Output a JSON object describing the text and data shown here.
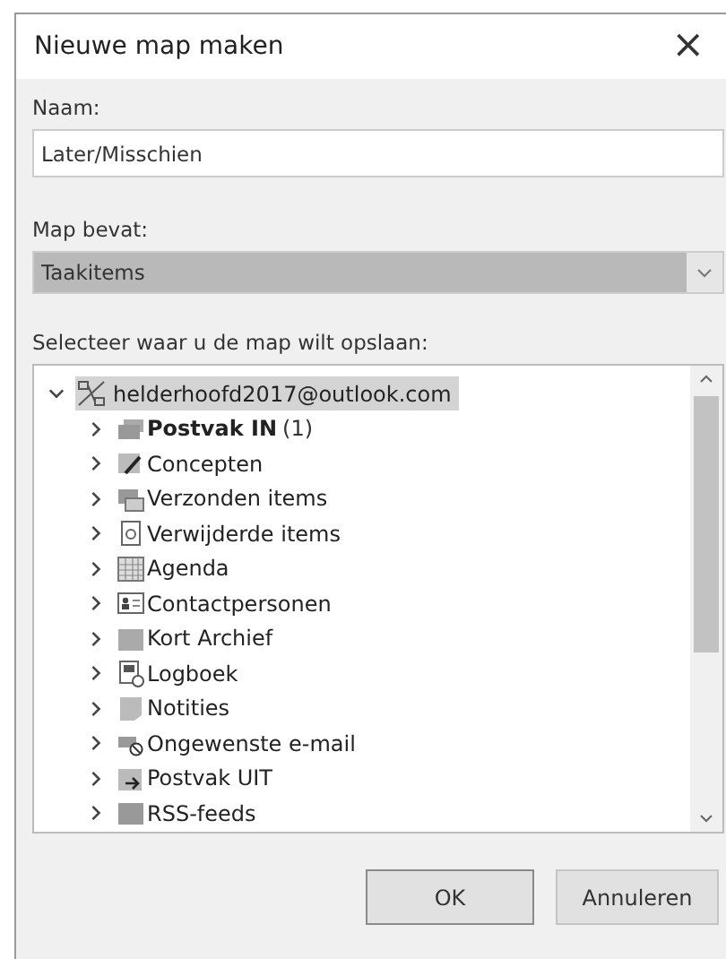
{
  "window": {
    "title": "Nieuwe map maken",
    "close": "×"
  },
  "name_field": {
    "label": "Naam:",
    "value": "Later/Misschien"
  },
  "contains": {
    "label": "Map bevat:",
    "value": "Taakitems",
    "selected": true
  },
  "location": {
    "label": "Selecteer waar u de map wilt opslaan:",
    "tree": [
      {
        "label": "helderhoofd2017@outlook.com",
        "expanded": true,
        "selected": true,
        "children": [
          {
            "label": "Postvak IN",
            "count": "(1)",
            "unread": true,
            "expanded": false,
            "selected": false
          },
          {
            "label": "Concepten",
            "unread": false,
            "expanded": false,
            "selected": false
          },
          {
            "label": "Verzonden items",
            "unread": false,
            "expanded": false,
            "selected": false
          },
          {
            "label": "Verwijderde items",
            "unread": false,
            "expanded": false,
            "selected": false
          },
          {
            "label": "Agenda",
            "unread": false,
            "expanded": false,
            "selected": false
          },
          {
            "label": "Contactpersonen",
            "unread": false,
            "expanded": false,
            "selected": false
          },
          {
            "label": "Kort Archief",
            "unread": false,
            "expanded": false,
            "selected": false
          },
          {
            "label": "Logboek",
            "unread": false,
            "expanded": false,
            "selected": false
          },
          {
            "label": "Notities",
            "unread": false,
            "expanded": false,
            "selected": false
          },
          {
            "label": "Ongewenste e-mail",
            "unread": false,
            "expanded": false,
            "selected": false
          },
          {
            "label": "Postvak UIT",
            "unread": false,
            "expanded": false,
            "selected": false
          },
          {
            "label": "RSS-feeds",
            "unread": false,
            "expanded": false,
            "selected": false
          }
        ]
      }
    ]
  },
  "buttons": [
    {
      "label": "OK",
      "default": true
    },
    {
      "label": "Annuleren",
      "default": false
    }
  ]
}
